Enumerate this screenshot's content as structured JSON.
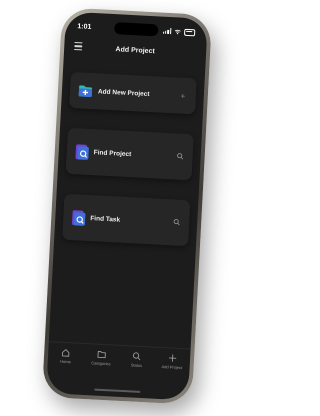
{
  "status_bar": {
    "time": "1:01"
  },
  "header": {
    "title": "Add Project",
    "menu_icon": "hamburger-icon"
  },
  "cards": [
    {
      "label": "Add New Project",
      "icon": "folder-plus-icon",
      "trailing_icon": "plus-icon",
      "trailing_glyph": "+"
    },
    {
      "label": "Find Project",
      "icon": "folder-search-icon",
      "trailing_icon": "search-icon",
      "trailing_glyph": "⌕"
    },
    {
      "label": "Find Task",
      "icon": "task-search-icon",
      "trailing_icon": "search-icon",
      "trailing_glyph": "⌕"
    }
  ],
  "tabs": [
    {
      "label": "Home",
      "icon": "home-icon"
    },
    {
      "label": "Categories",
      "icon": "categories-icon"
    },
    {
      "label": "Status",
      "icon": "search-icon"
    },
    {
      "label": "Add Project",
      "icon": "plus-icon"
    }
  ],
  "colors": {
    "screen_bg": "#1c1c1c",
    "card_bg": "#262626",
    "accent_blue": "#3f6fd8",
    "accent_teal": "#2fb9b0",
    "accent_purple": "#6f43d6"
  }
}
